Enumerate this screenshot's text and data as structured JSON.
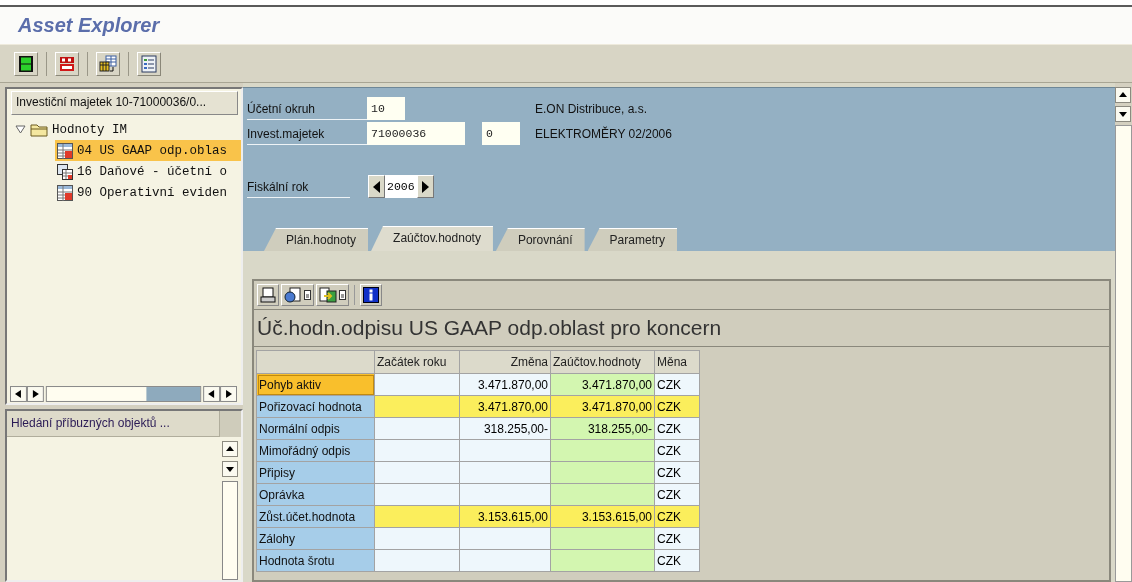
{
  "window": {
    "title": "Asset Explorer"
  },
  "tree_panel": {
    "header": "Investiční majetek 10-71000036/0...",
    "items": [
      {
        "label": "Hodnoty IM",
        "expanded": true,
        "children": [
          {
            "label": "04 US GAAP odp.oblas",
            "kind": "table",
            "selected": true
          },
          {
            "label": "16 Daňové - účetní o",
            "kind": "multi",
            "selected": false
          },
          {
            "label": "90 Operativní eviden",
            "kind": "table",
            "selected": false
          }
        ]
      }
    ]
  },
  "search_panel": {
    "header": "Hledání příbuzných objektů ..."
  },
  "header_fields": [
    {
      "label": "Účetní okruh",
      "value": "10",
      "description": "E.ON Distribuce, a.s."
    },
    {
      "label": "Invest.majetek",
      "value": "71000036",
      "subnumber": "0",
      "description": "ELEKTROMĚRY 02/2006"
    }
  ],
  "fiscal_year": {
    "label": "Fiskální rok",
    "value": "2006"
  },
  "tabs": [
    {
      "label": "Plán.hodnoty",
      "selected": false
    },
    {
      "label": "Zaúčtov.hodnoty",
      "selected": true
    },
    {
      "label": "Porovnání",
      "selected": false
    },
    {
      "label": "Parametry",
      "selected": false
    }
  ],
  "table_title": "Úč.hodn.odpisu US GAAP odp.oblast pro koncern",
  "table": {
    "columns": [
      "Začátek roku",
      "Změna",
      "Zaúčtov.hodnoty",
      "Měna"
    ],
    "rows": [
      {
        "label": "Pohyb aktiv",
        "kind": "normal",
        "selected": true,
        "cells": [
          null,
          "3.471.870,00",
          "3.471.870,00",
          "CZK"
        ]
      },
      {
        "label": "Pořizovací hodnota",
        "kind": "total",
        "selected": false,
        "cells": [
          null,
          "3.471.870,00",
          "3.471.870,00",
          "CZK"
        ]
      },
      {
        "label": "Normální odpis",
        "kind": "normal",
        "selected": false,
        "cells": [
          null,
          "318.255,00-",
          "318.255,00-",
          "CZK"
        ]
      },
      {
        "label": "Mimořádný odpis",
        "kind": "normal",
        "selected": false,
        "cells": [
          null,
          null,
          null,
          "CZK"
        ]
      },
      {
        "label": "Připisy",
        "kind": "normal",
        "selected": false,
        "cells": [
          null,
          null,
          null,
          "CZK"
        ]
      },
      {
        "label": "Oprávka",
        "kind": "normal",
        "selected": false,
        "cells": [
          null,
          null,
          null,
          "CZK"
        ]
      },
      {
        "label": "Zůst.účet.hodnota",
        "kind": "total",
        "selected": false,
        "cells": [
          null,
          "3.153.615,00",
          "3.153.615,00",
          "CZK"
        ]
      },
      {
        "label": "Zálohy",
        "kind": "normal",
        "selected": false,
        "cells": [
          null,
          null,
          null,
          "CZK"
        ]
      },
      {
        "label": "Hodnota šrotu",
        "kind": "normal",
        "selected": false,
        "cells": [
          null,
          null,
          null,
          "CZK"
        ]
      }
    ]
  }
}
